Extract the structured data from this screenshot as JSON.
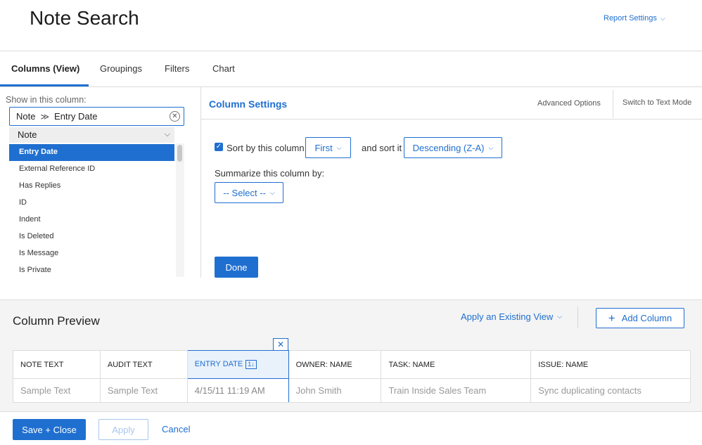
{
  "header": {
    "title": "Note Search",
    "report_settings": "Report Settings"
  },
  "tabs": [
    {
      "label": "Columns (View)"
    },
    {
      "label": "Groupings"
    },
    {
      "label": "Filters"
    },
    {
      "label": "Chart"
    }
  ],
  "left_panel": {
    "show_label": "Show in this column:",
    "picker": {
      "object": "Note",
      "field": "Entry Date"
    },
    "group": "Note",
    "fields": [
      "Entry Date",
      "External Reference ID",
      "Has Replies",
      "ID",
      "Indent",
      "Is Deleted",
      "Is Message",
      "Is Private"
    ],
    "selected_field": "Entry Date"
  },
  "column_settings": {
    "title": "Column Settings",
    "advanced_options": "Advanced Options",
    "switch_text_mode": "Switch to Text Mode",
    "sort_label": "Sort by this column",
    "sort_checked": true,
    "sort_order": "First",
    "sort_it_label": "and sort it",
    "sort_direction": "Descending (Z-A)",
    "summarize_label": "Summarize this column by:",
    "summarize_value": "-- Select --",
    "done": "Done"
  },
  "preview": {
    "title": "Column Preview",
    "apply_view": "Apply an Existing View",
    "add_column": "Add Column",
    "close_glyph": "✕",
    "sort_badge": "1↓",
    "columns": [
      "NOTE TEXT",
      "AUDIT TEXT",
      "ENTRY DATE",
      "OWNER: NAME",
      "TASK: NAME",
      "ISSUE: NAME"
    ],
    "selected_column": "ENTRY DATE",
    "row": [
      "Sample Text",
      "Sample Text",
      "4/15/11 11:19 AM",
      "John Smith",
      "Train Inside Sales Team",
      "Sync duplicating contacts"
    ]
  },
  "footer": {
    "save_close": "Save + Close",
    "apply": "Apply",
    "cancel": "Cancel"
  },
  "colors": {
    "accent": "#1f6fd0",
    "selected_row": "#1f6fd0",
    "preview_bg": "#f4f4f4"
  }
}
